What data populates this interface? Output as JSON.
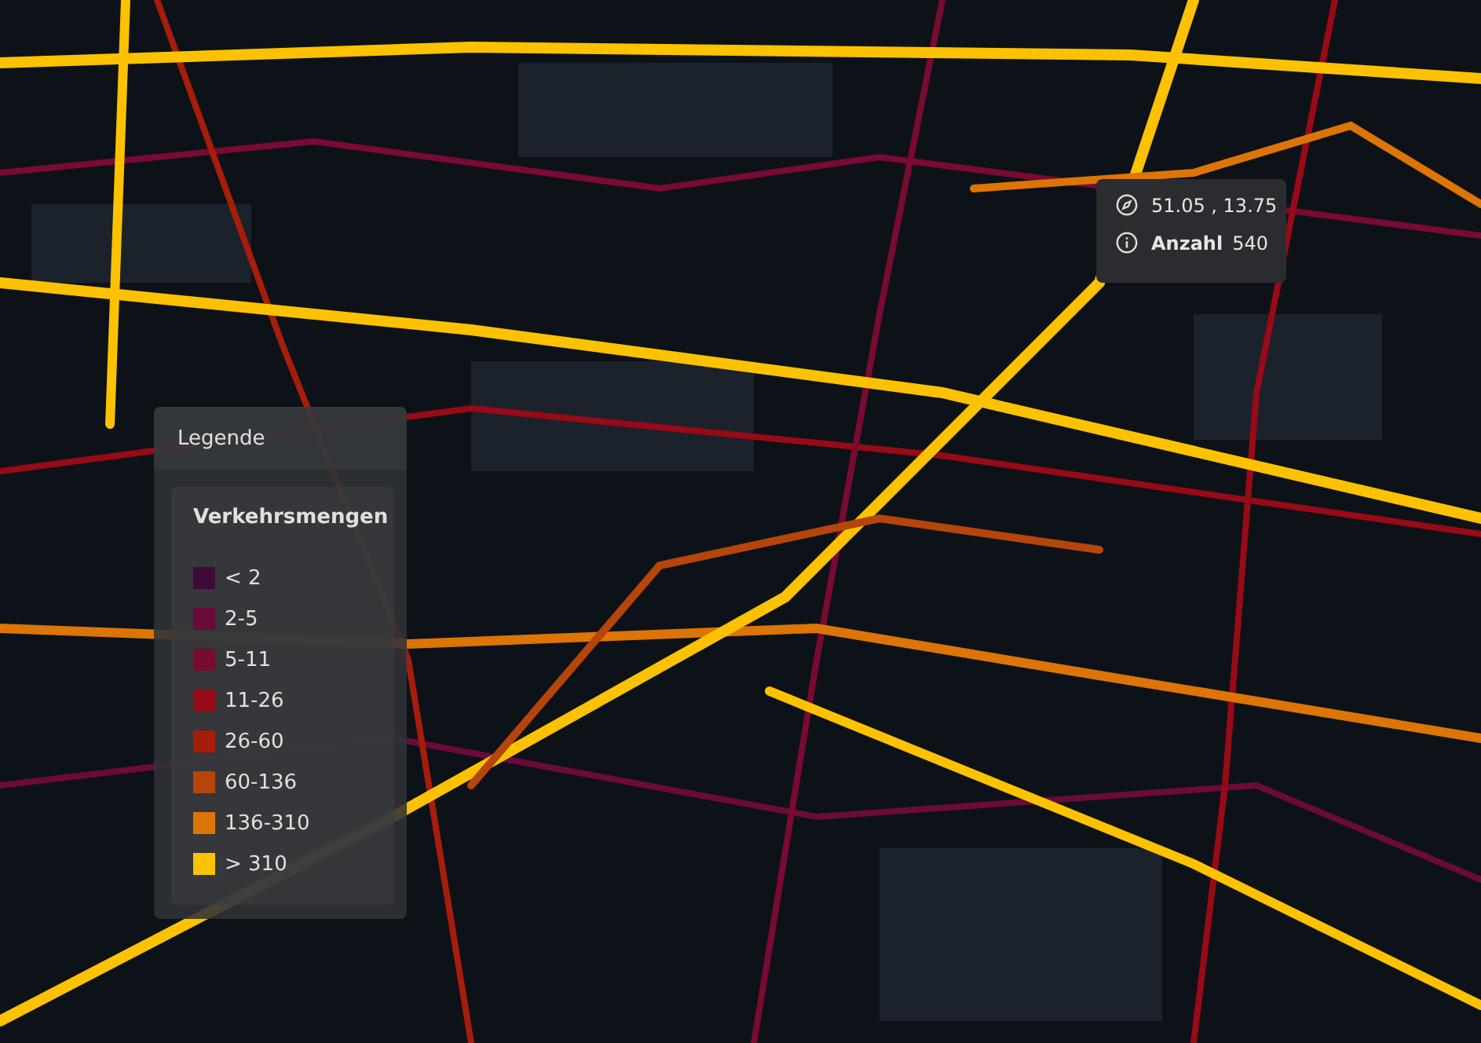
{
  "tooltip": {
    "coordinates": "51.05 , 13.75",
    "label": "Anzahl",
    "value": "540"
  },
  "legend": {
    "title": "Legende",
    "heading": "Verkehrsmengen",
    "items": [
      {
        "label": "< 2",
        "color": "#3f0a38"
      },
      {
        "label": "2-5",
        "color": "#6a0b3a"
      },
      {
        "label": "5-11",
        "color": "#790a30"
      },
      {
        "label": "11-26",
        "color": "#970a16"
      },
      {
        "label": "26-60",
        "color": "#a61d0b"
      },
      {
        "label": "60-136",
        "color": "#b5450b"
      },
      {
        "label": "136-310",
        "color": "#dd7406"
      },
      {
        "label": "> 310",
        "color": "#fcc200"
      }
    ]
  }
}
